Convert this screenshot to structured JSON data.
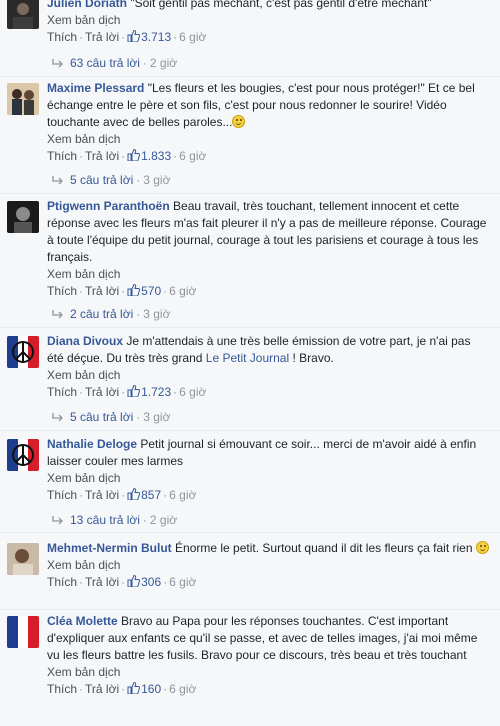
{
  "labels": {
    "translate": "Xem bản dịch",
    "like": "Thích",
    "reply": "Trả lời",
    "dot": "·"
  },
  "comments": [
    {
      "author": "Julien Doriath",
      "text": "\"Soit gentil pas méchant, c'est pas gentil d'être méchant\"",
      "likes": "3.713",
      "time": "6 giờ",
      "replies": "63 câu trả lời",
      "reply_time": "2 giờ"
    },
    {
      "author": "Maxime Plessard",
      "text": "\"Les fleurs et les bougies, c'est pour nous protéger!\" Et ce bel échange entre le père et son fils, c'est pour nous redonner le sourire! Vidéo touchante avec de belles paroles...",
      "likes": "1.833",
      "time": "6 giờ",
      "replies": "5 câu trả lời",
      "reply_time": "3 giờ"
    },
    {
      "author": "Ptigwenn Paranthoën",
      "text": "Beau travail, très touchant, tellement innocent et cette réponse avec les fleurs m'as fait pleurer il n'y a pas de meilleure réponse. Courage à toute l'équipe du petit journal, courage à tout les parisiens et courage à tous les français.",
      "likes": "570",
      "time": "6 giờ",
      "replies": "2 câu trả lời",
      "reply_time": "3 giờ"
    },
    {
      "author": "Diana Divoux",
      "text_before": "Je m'attendais à une très belle émission de votre part, je n'ai pas été déçue. Du très très grand ",
      "link": "Le Petit Journal",
      "text_after": " ! Bravo.",
      "likes": "1.723",
      "time": "6 giờ",
      "replies": "5 câu trả lời",
      "reply_time": "3 giờ"
    },
    {
      "author": "Nathalie Deloge",
      "text": "Petit journal si émouvant ce soir... merci de m'avoir aidé à enfin laisser couler mes larmes",
      "likes": "857",
      "time": "6 giờ",
      "replies": "13 câu trả lời",
      "reply_time": "2 giờ"
    },
    {
      "author": "Mehmet-Nermin Bulut",
      "text": "Énorme le petit. Surtout quand il dit les fleurs ça fait rien",
      "likes": "306",
      "time": "6 giờ"
    },
    {
      "author": "Cléa Molette",
      "text": "Bravo au Papa pour les réponses touchantes. C'est important d'expliquer aux enfants ce qu'il se passe, et avec de telles images, j'ai moi même vu les fleurs battre les fusils. Bravo pour ce discours, très beau et très touchant",
      "likes": "160",
      "time": "6 giờ"
    }
  ],
  "colors": {
    "link": "#365899",
    "meta": "#90949c",
    "background": "#f6f7f9",
    "flag_blue": "#1d3d8f",
    "flag_red": "#d51e2a"
  }
}
